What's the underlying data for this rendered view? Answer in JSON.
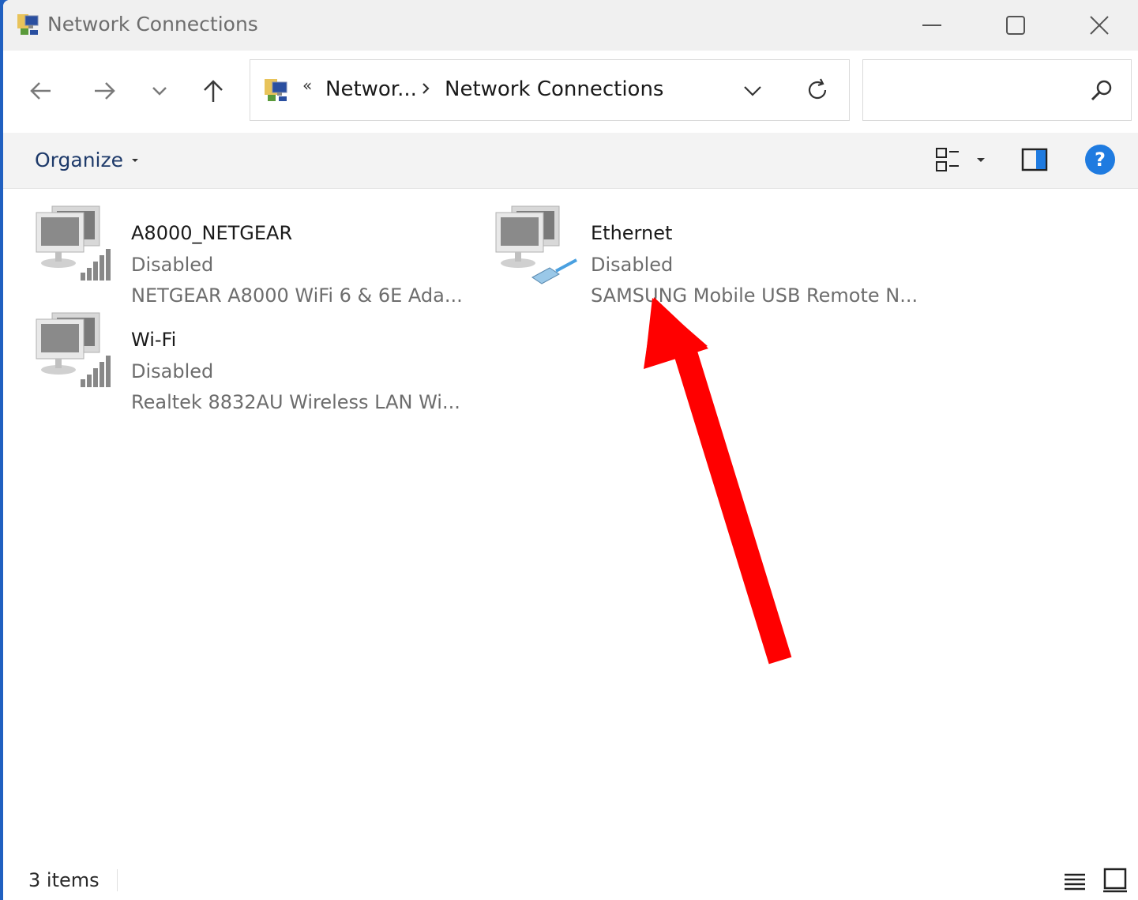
{
  "window": {
    "title": "Network Connections",
    "controls": {
      "minimize": "minimize",
      "maximize": "maximize",
      "close": "close"
    }
  },
  "navigation": {
    "back_icon": "arrow-left-icon",
    "forward_icon": "arrow-right-icon",
    "recent_icon": "chevron-down-icon",
    "up_icon": "arrow-up-icon"
  },
  "address_bar": {
    "overflow_chevron": "«",
    "breadcrumbs": [
      "Networ...",
      "Network Connections"
    ],
    "refresh_icon": "refresh-icon"
  },
  "search": {
    "placeholder": "",
    "icon": "search-icon"
  },
  "command_bar": {
    "organize_label": "Organize",
    "help_label": "?"
  },
  "connections": [
    {
      "name": "A8000_NETGEAR",
      "status": "Disabled",
      "device": "NETGEAR A8000 WiFi 6 & 6E Ada...",
      "type": "wireless"
    },
    {
      "name": "Ethernet",
      "status": "Disabled",
      "device": "SAMSUNG Mobile USB Remote N...",
      "type": "ethernet"
    },
    {
      "name": "Wi-Fi",
      "status": "Disabled",
      "device": "Realtek 8832AU Wireless LAN Wi...",
      "type": "wireless"
    }
  ],
  "status_bar": {
    "item_count": "3 items"
  },
  "annotation": {
    "arrow_color": "#ff0000"
  },
  "colors": {
    "accent": "#1f7be0",
    "frame": "#2060c0"
  }
}
